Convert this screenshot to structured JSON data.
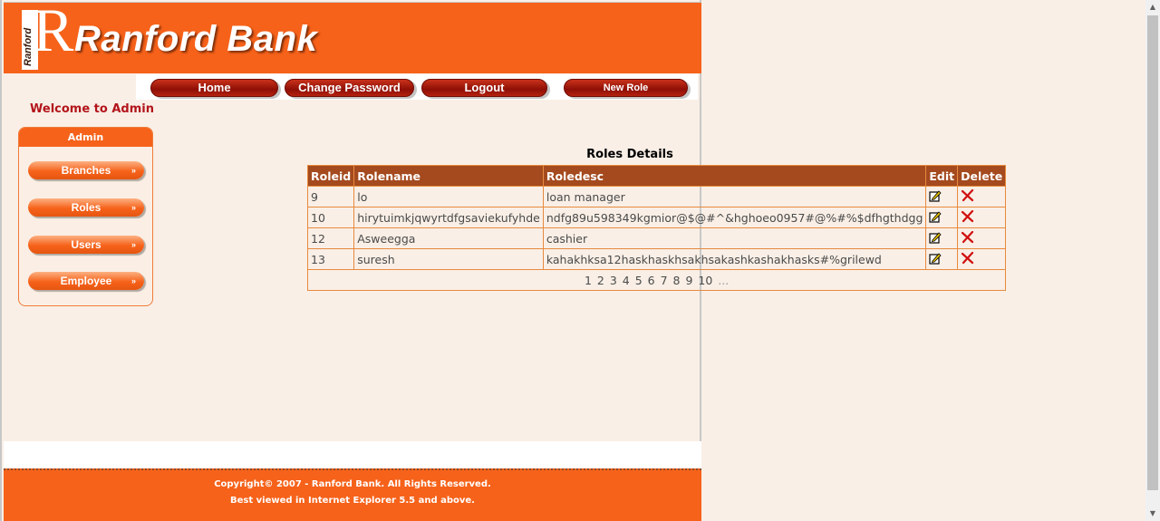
{
  "header": {
    "logo_text": "Ranford",
    "logo_letter": "R",
    "bank_name": "Ranford Bank"
  },
  "nav": {
    "home": "Home",
    "change_password": "Change Password",
    "logout": "Logout",
    "new_role": "New Role"
  },
  "welcome": "Welcome to Admin",
  "sidebar": {
    "title": "Admin",
    "items": [
      {
        "label": "Branches"
      },
      {
        "label": "Roles"
      },
      {
        "label": "Users"
      },
      {
        "label": "Employee"
      }
    ],
    "arrow": "»"
  },
  "roles": {
    "title": "Roles Details",
    "columns": [
      "Roleid",
      "Rolename",
      "Roledesc",
      "Edit",
      "Delete"
    ],
    "rows": [
      {
        "id": "9",
        "name": "lo",
        "desc": "loan manager"
      },
      {
        "id": "10",
        "name": "hirytuimkjqwyrtdfgsaviekufyhde",
        "desc": "ndfg89u598349kgmior@$@#^&hghoeo0957#@%#%$dfhgthdgg"
      },
      {
        "id": "12",
        "name": "Asweegga",
        "desc": "cashier"
      },
      {
        "id": "13",
        "name": "suresh",
        "desc": "kahakhksa12haskhaskhsakhsakashkashakhasks#%grilewd"
      }
    ],
    "pages": [
      "1",
      "2",
      "3",
      "4",
      "5",
      "6",
      "7",
      "8",
      "9",
      "10",
      "..."
    ]
  },
  "footer": {
    "copyright": "Copyright© 2007 - Ranford Bank. All Rights Reserved.",
    "note": "Best viewed in Internet Explorer 5.5 and above."
  },
  "colors": {
    "brand_orange": "#f6621a",
    "table_header": "#a44a1e",
    "nav_red": "#8e0f06",
    "welcome_red": "#b3141b"
  }
}
